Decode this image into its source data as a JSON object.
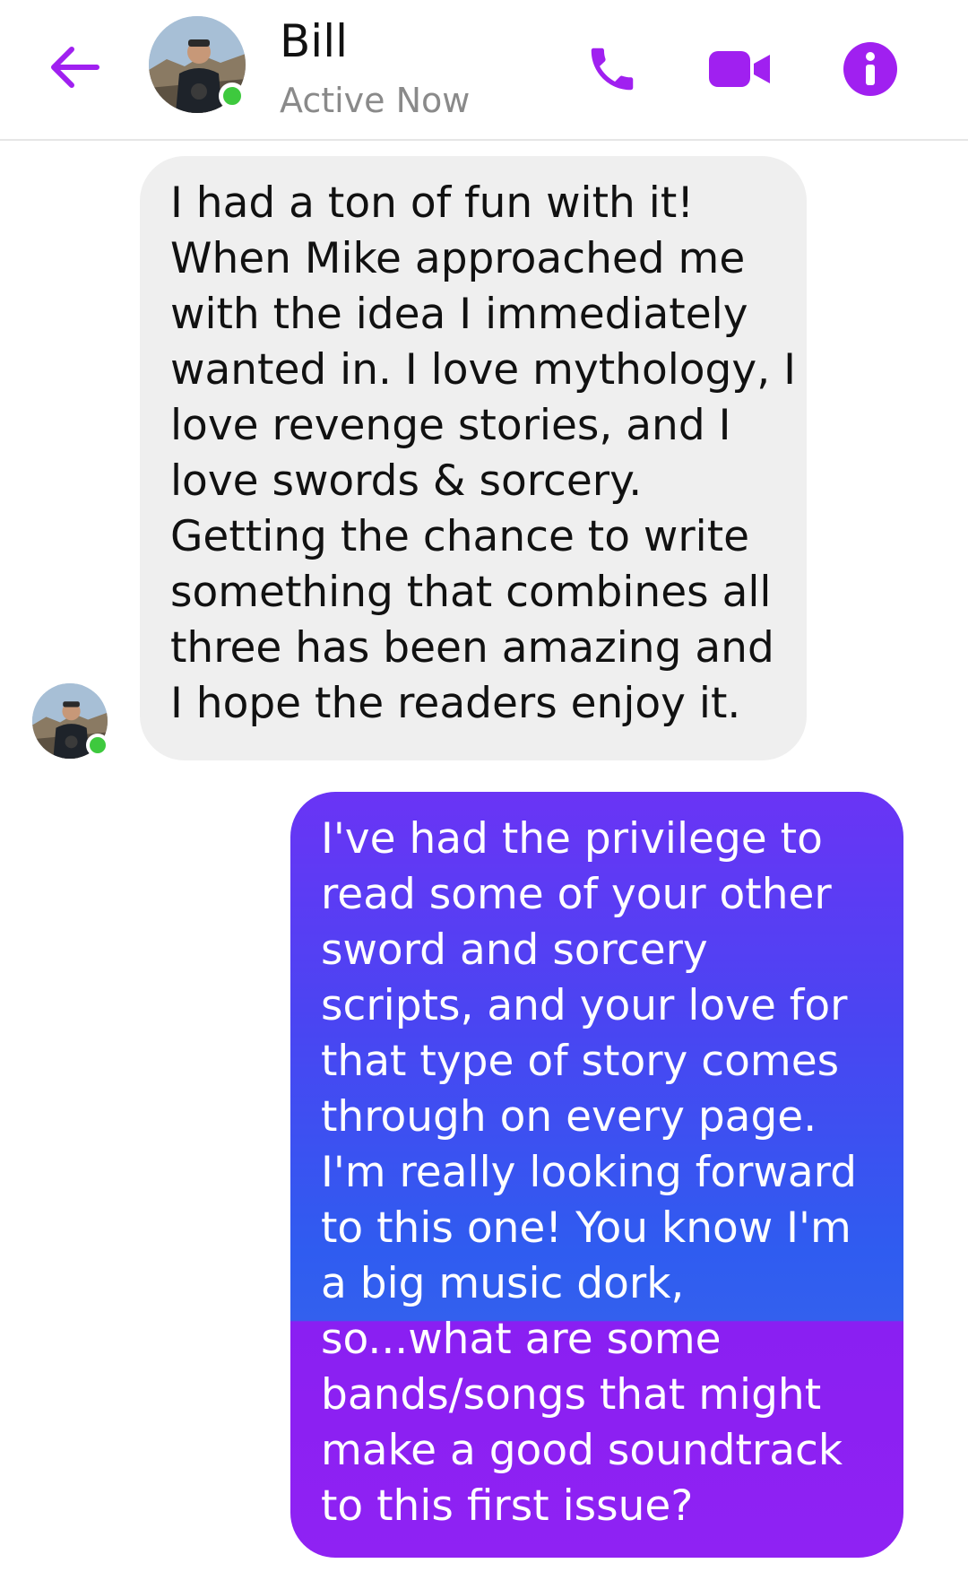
{
  "header": {
    "name": "Bill",
    "status": "Active Now"
  },
  "icons": {
    "back": "arrow-left-icon",
    "phone": "phone-icon",
    "video": "video-camera-icon",
    "info": "info-icon"
  },
  "colors": {
    "accent": "#a020f0",
    "presence": "#3ec93e",
    "incoming_bubble": "#efefef",
    "outgoing_top": "#6a34f5",
    "outgoing_mid": "#2f5cf0",
    "outgoing_bottom": "#8f22f3"
  },
  "messages": [
    {
      "direction": "incoming",
      "lines": [
        "I had a ton of fun with it!",
        "When Mike approached me",
        "with the idea I immediately",
        "wanted in. I love mythology, I",
        "love revenge stories, and I",
        "love swords & sorcery.",
        "Getting the chance to write",
        "something that combines all",
        "three has been amazing and",
        "I hope the readers enjoy it."
      ]
    },
    {
      "direction": "outgoing",
      "lines": [
        "I've had the privilege to",
        "read some of your other",
        "sword and sorcery",
        "scripts, and your love for",
        "that type of story comes",
        "through on every page.",
        "I'm really looking forward",
        "to this one! You know I'm",
        "a big music dork,",
        "so...what are some",
        "bands/songs that might",
        "make a good soundtrack",
        "to this first issue?"
      ]
    }
  ]
}
